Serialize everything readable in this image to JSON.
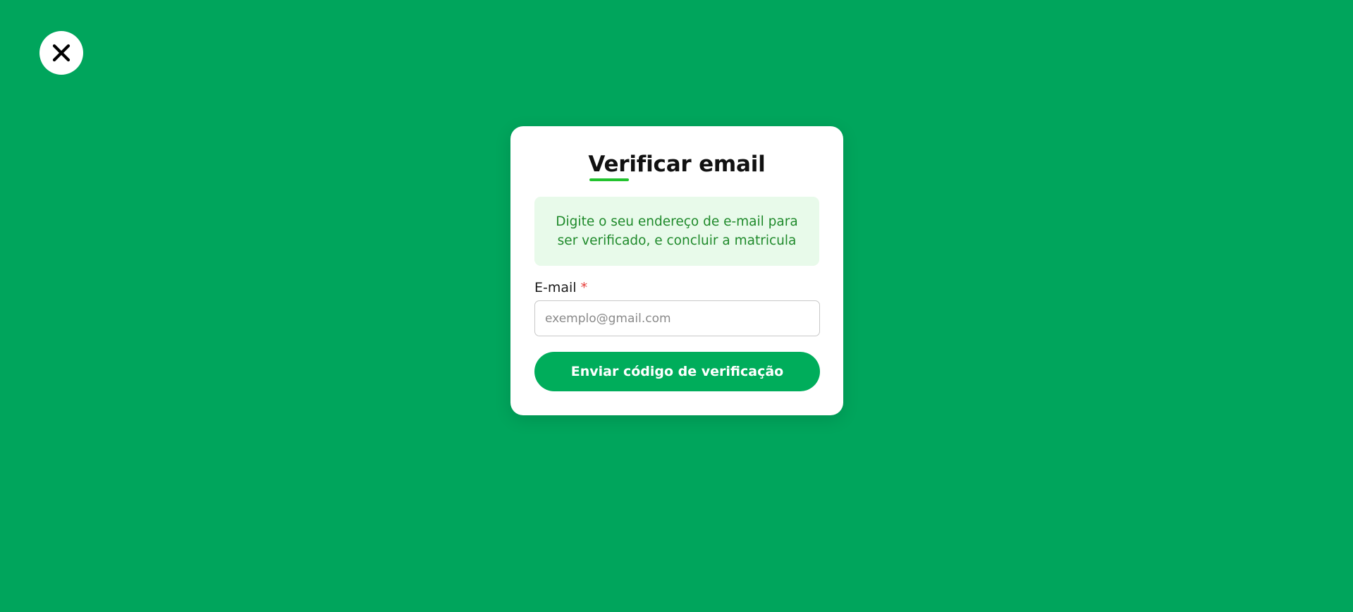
{
  "close_button": {
    "icon": "close-icon",
    "color": "#000000"
  },
  "card": {
    "title": "Verificar email",
    "info": "Digite o seu endereço de e-mail para ser verificado, e concluir a matricula",
    "email_label": "E-mail",
    "required_mark": "*",
    "email_placeholder": "exemplo@gmail.com",
    "email_value": "",
    "submit_label": "Enviar código de verificação"
  },
  "colors": {
    "background": "#00a55c",
    "button": "#00ad5b",
    "accent_underline": "#22c32e",
    "info_background": "#e8faea",
    "info_text": "#1f8a2b",
    "required": "#e53935"
  }
}
